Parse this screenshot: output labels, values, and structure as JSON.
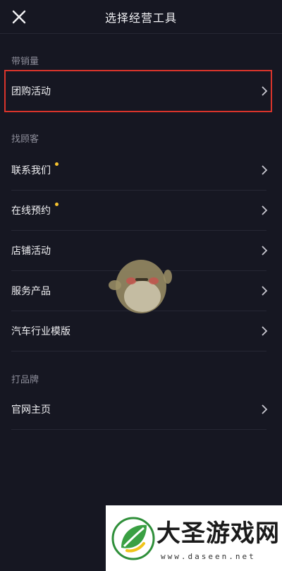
{
  "header": {
    "title": "选择经营工具",
    "close_icon": "close-icon"
  },
  "sections": [
    {
      "label": "带销量",
      "items": [
        {
          "label": "团购活动",
          "dot": false,
          "highlighted": true
        }
      ]
    },
    {
      "label": "找顾客",
      "items": [
        {
          "label": "联系我们",
          "dot": true
        },
        {
          "label": "在线预约",
          "dot": true
        },
        {
          "label": "店铺活动",
          "dot": false
        },
        {
          "label": "服务产品",
          "dot": false
        },
        {
          "label": "汽车行业模版",
          "dot": false
        }
      ]
    },
    {
      "label": "打品牌",
      "items": [
        {
          "label": "官网主页",
          "dot": false
        }
      ]
    }
  ],
  "watermark": {
    "name": "大圣游戏网",
    "url": "www.daseen.net",
    "logo_icon": "leaf-logo-icon"
  },
  "colors": {
    "background": "#161722",
    "highlight": "#d9342b",
    "dot": "#f6c22f",
    "section_label": "#8d8e9a"
  }
}
